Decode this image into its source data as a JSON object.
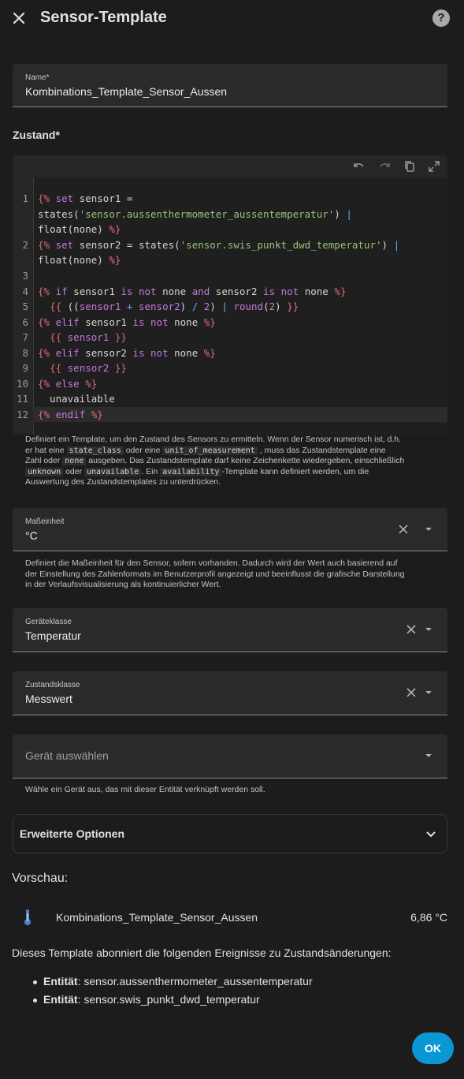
{
  "dialog": {
    "title": "Sensor-Template",
    "help": "?"
  },
  "name_field": {
    "label": "Name*",
    "value": "Kombinations_Template_Sensor_Aussen"
  },
  "state_section": {
    "label": "Zustand*"
  },
  "editor": {
    "line_numbers": [
      "1",
      "2",
      "3",
      "4",
      "5",
      "6",
      "7",
      "8",
      "9",
      "10",
      "11",
      "12"
    ],
    "icons": [
      "undo-icon",
      "redo-icon",
      "copy-icon",
      "fullscreen-icon"
    ]
  },
  "state_helper": {
    "p1": "Definiert ein Template, um den Zustand des Sensors zu ermitteln. Wenn der Sensor numerisch ist, d.h.",
    "p2a": "er hat eine",
    "code_state_class": "state_class",
    "p2b": "oder eine",
    "code_unit": "unit_of_measurement",
    "p2c": ", muss das Zustandstemplate eine",
    "p3a": "Zahl oder",
    "code_none": "none",
    "p3b": "ausgeben. Das Zustandstemplate darf keine Zeichenkette wiedergeben, einschließlich",
    "code_unknown": "unknown",
    "p4a": "oder",
    "code_unavailable": "unavailable",
    "p4b": ". Ein",
    "code_availability": "availability",
    "p4c": "-Template kann definiert werden, um die",
    "p5": "Auswertung des Zustandstemplates zu unterdrücken."
  },
  "unit_field": {
    "label": "Maßeinheit",
    "value": "°C"
  },
  "unit_helper": {
    "l1": "Definiert die Maßeinheit für den Sensor, sofern vorhanden. Dadurch wird der Wert auch basierend auf",
    "l2": "der Einstellung des Zahlenformats im Benutzerprofil angezeigt und beeinflusst die grafische Darstellung",
    "l3": "in der Verlaufsvisualisierung als kontinuierlicher Wert."
  },
  "device_class_field": {
    "label": "Geräteklasse",
    "value": "Temperatur"
  },
  "state_class_field": {
    "label": "Zustandsklasse",
    "value": "Messwert"
  },
  "device_field": {
    "placeholder": "Gerät auswählen"
  },
  "device_helper": {
    "text": "Wähle ein Gerät aus, das mit dieser Entität verknüpft werden soll."
  },
  "advanced": {
    "label": "Erweiterte Optionen"
  },
  "preview": {
    "title": "Vorschau:",
    "entity_name": "Kombinations_Template_Sensor_Aussen",
    "state": "6,86 °C"
  },
  "subscriptions": {
    "intro": "Dieses Template abonniert die folgenden Ereignisse zu Zustandsänderungen:",
    "items": [
      {
        "prefix": "Entität",
        "entity": ": sensor.aussenthermometer_aussentemperatur"
      },
      {
        "prefix": "Entität",
        "entity": ": sensor.swis_punkt_dwd_temperatur"
      }
    ]
  },
  "ok_button": {
    "label": "OK"
  },
  "colors": {
    "background": "#1c1c1c",
    "field_bg": "#2a2a2a",
    "accent": "#0a98d4",
    "code_tag": "#e06c75",
    "code_keyword": "#c678dd",
    "code_string": "#98c379",
    "code_operator": "#61afef"
  }
}
